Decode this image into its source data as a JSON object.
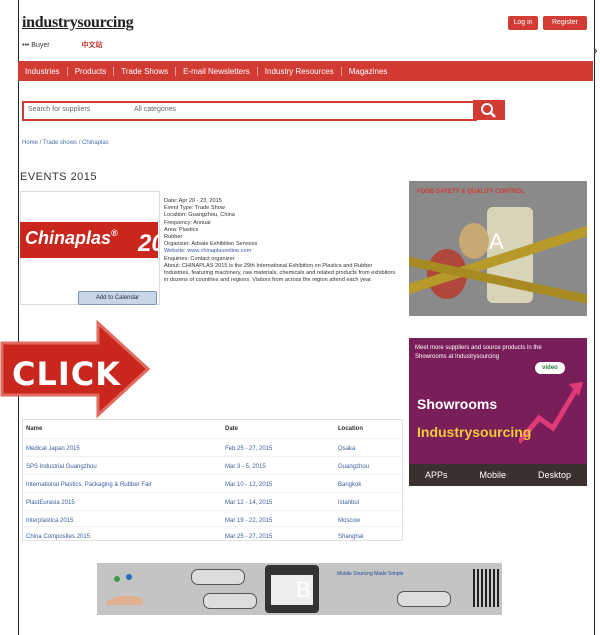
{
  "header": {
    "logo": "industrysourcing",
    "sublogo_left": "••• Buyer",
    "sublogo_right": "中文站",
    "login_label": "Log in",
    "register_label": "Register"
  },
  "nav": {
    "items": [
      "Industries",
      "Products",
      "Trade Shows",
      "E-mail Newsletters",
      "Industry Resources",
      "Magazines"
    ]
  },
  "search": {
    "field_placeholder": "Search for suppliers",
    "category_placeholder": "All categories"
  },
  "breadcrumb": "Home / Trade shows / Chinaplas",
  "event": {
    "title": "EVENTS 2015",
    "logo_word": "Chinaplas",
    "logo_reg": "®",
    "logo_num": "20",
    "add_to_calendar_label": "Add to Calendar",
    "details": [
      "Date: Apr 20 - 23, 2015",
      "Event Type: Trade Show",
      "Location: Guangzhou, China",
      "Frequency: Annual",
      "Area: Plastics",
      "Rubber",
      "Organizer: Adsale Exhibition Services",
      "Website: www.chinaplasonline.com",
      "Enquiries: Contact organizer",
      "About: CHINAPLAS 2015 is the 29th International Exhibition on Plastics and Rubber Industries, featuring machinery, raw materials, chemicals and related products from exhibitors in dozens of countries and regions. Visitors from across the region attend each year."
    ]
  },
  "ads": {
    "ad_a": {
      "headline": "FOOD SAFETY & QUALITY CONTROL",
      "label": "A"
    },
    "ad_b": {
      "label": "B",
      "text": "Mobile Sourcing Made Simple"
    },
    "showrooms": {
      "top_text": "Meet more suppliers and source products in the Showrooms at Industrysourcing",
      "badge": "video",
      "line1": "Showrooms",
      "line2": "Industrysourcing",
      "footer": [
        "APPs",
        "Mobile",
        "Desktop"
      ]
    }
  },
  "click_badge": "CLICK",
  "related": {
    "headers": [
      "Name",
      "Date",
      "Location"
    ],
    "rows": [
      [
        "Medical Japan 2015",
        "Feb 25 - 27, 2015",
        "Osaka"
      ],
      [
        "SPS Industrial Guangzhou",
        "Mar 3 - 5, 2015",
        "Guangzhou"
      ],
      [
        "International Plastics, Packaging & Rubber Fair",
        "Mar 10 - 12, 2015",
        "Bangkok"
      ],
      [
        "PlastEurasia 2015",
        "Mar 12 - 14, 2015",
        "Istanbul"
      ],
      [
        "Interplastica 2015",
        "Mar 19 - 22, 2015",
        "Moscow"
      ],
      [
        "China Composites 2015",
        "Mar 25 - 27, 2015",
        "Shanghai"
      ]
    ]
  },
  "colors": {
    "brand_red": "#d23a34",
    "showroom_purple": "#7a1e5a",
    "link_blue": "#3a5d9c"
  }
}
